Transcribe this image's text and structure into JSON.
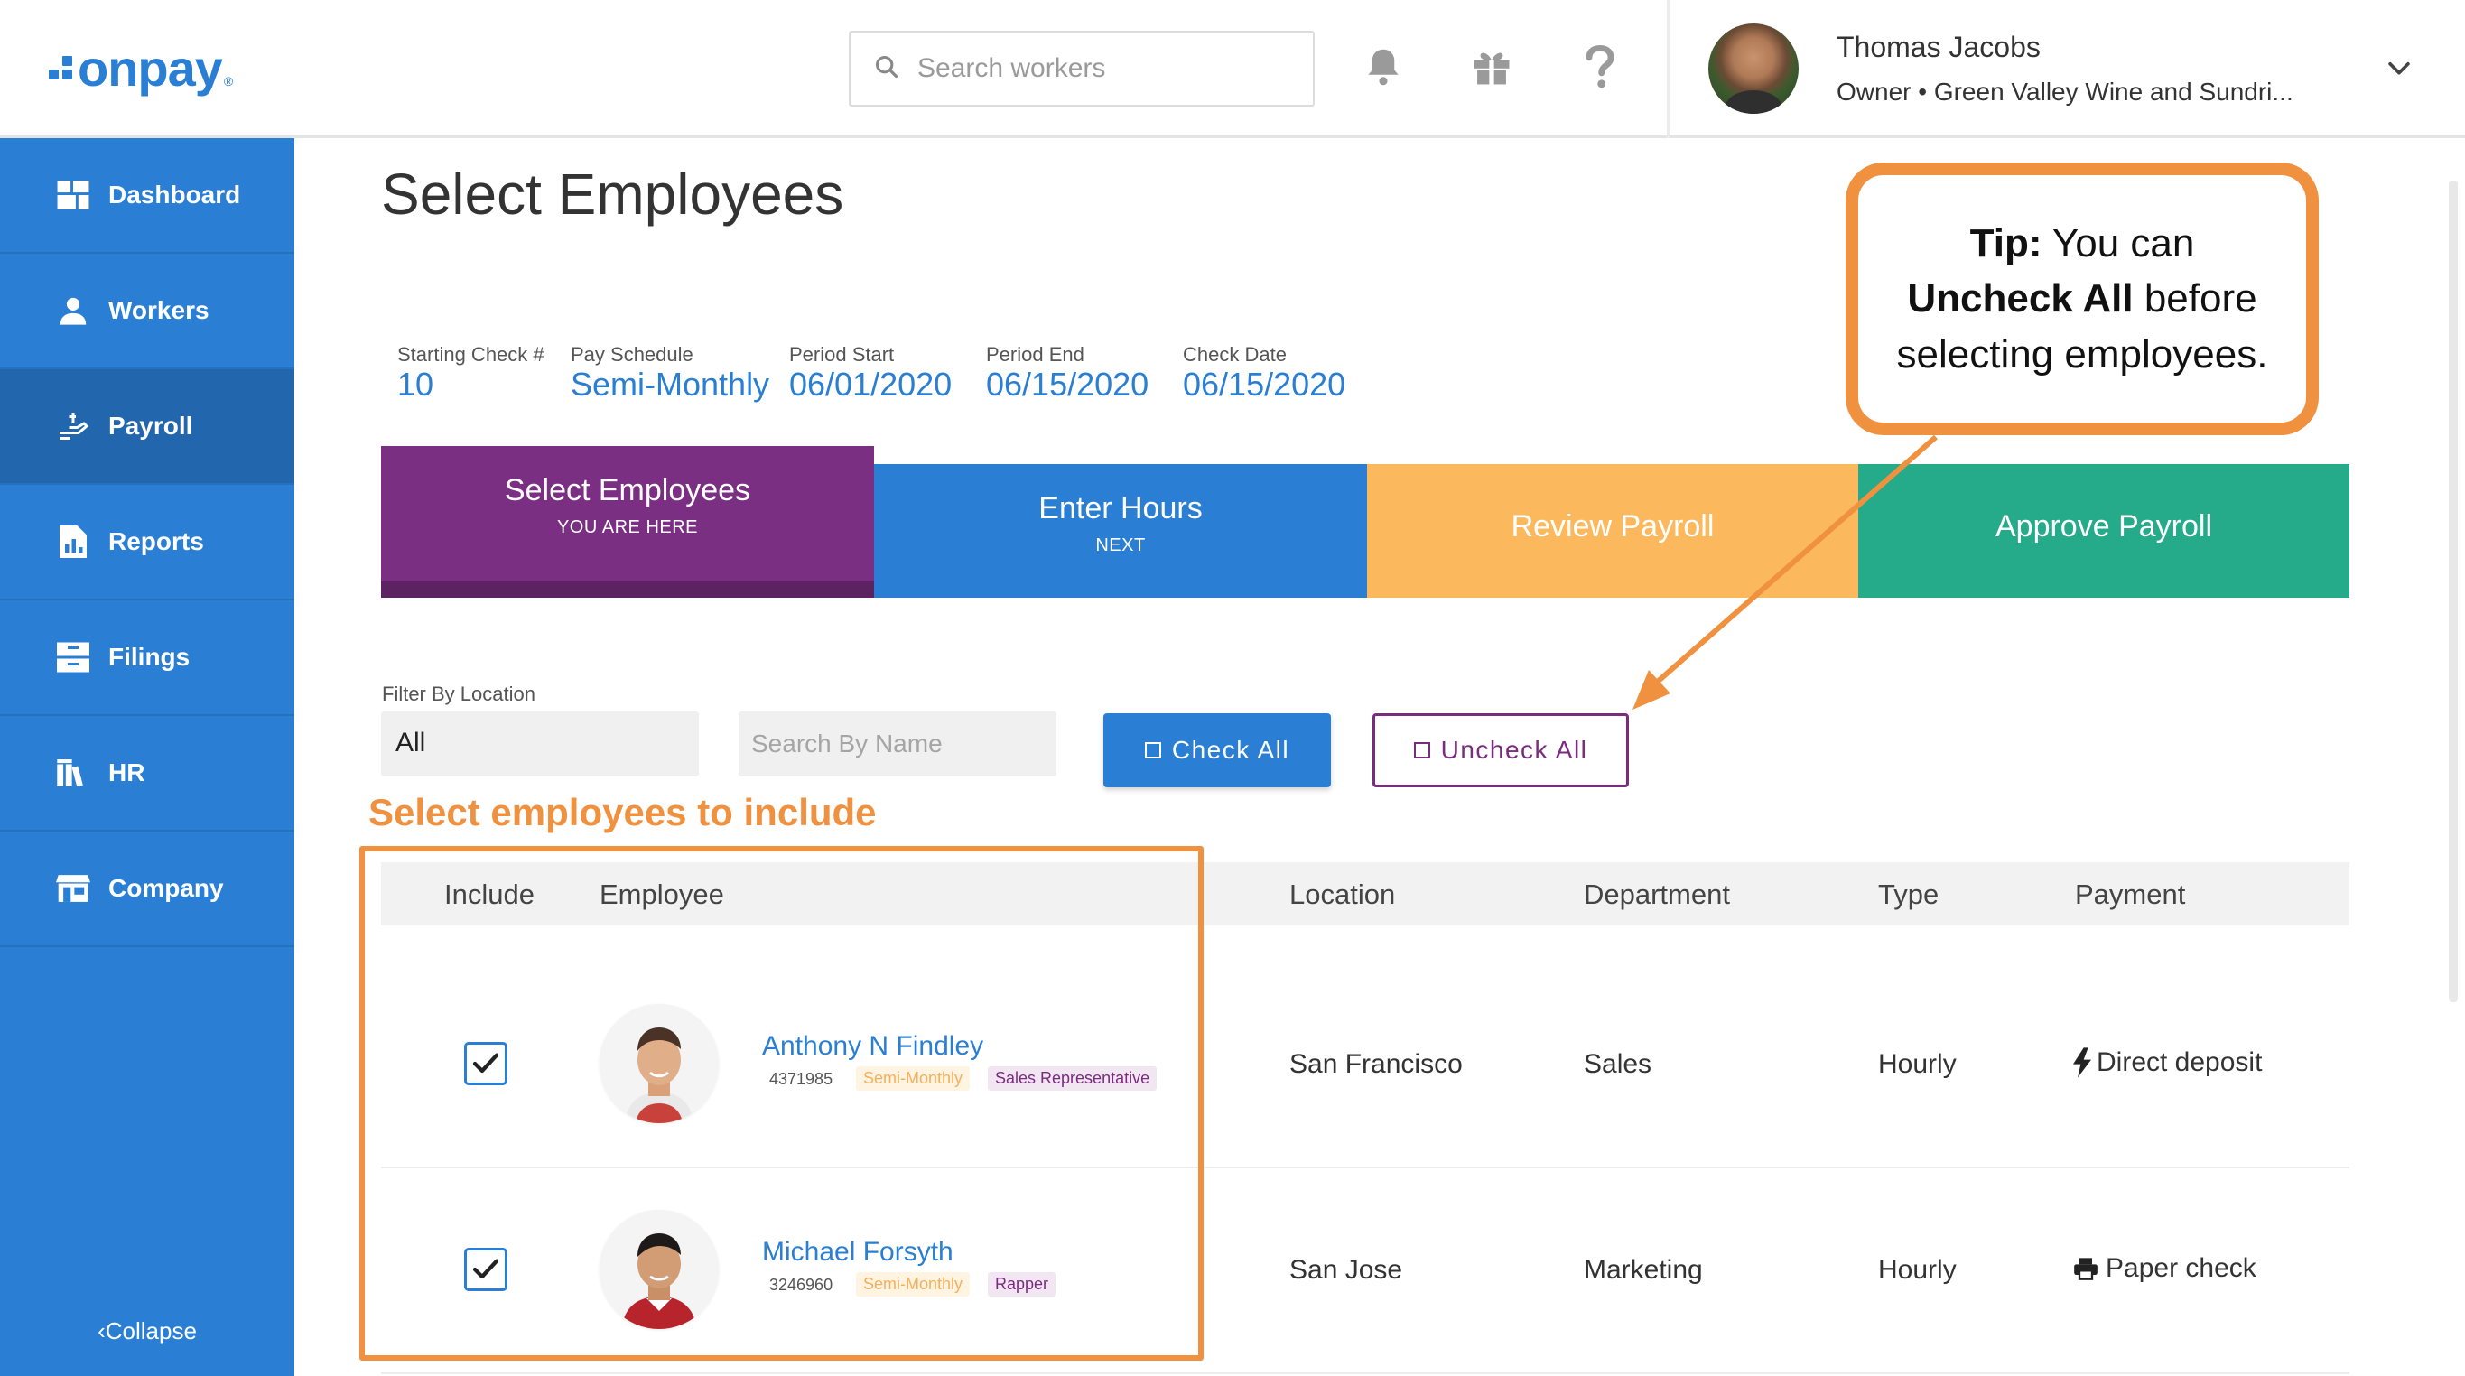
{
  "app": {
    "logo_text": "onpay",
    "logo_reg": "®"
  },
  "header": {
    "search_placeholder": "Search workers",
    "user": {
      "name": "Thomas Jacobs",
      "role": "Owner • Green Valley Wine and Sundri..."
    }
  },
  "sidebar": {
    "items": [
      {
        "label": "Dashboard",
        "icon": "dashboard-icon"
      },
      {
        "label": "Workers",
        "icon": "workers-icon"
      },
      {
        "label": "Payroll",
        "icon": "payroll-icon",
        "active": true
      },
      {
        "label": "Reports",
        "icon": "reports-icon"
      },
      {
        "label": "Filings",
        "icon": "filings-icon"
      },
      {
        "label": "HR",
        "icon": "hr-icon"
      },
      {
        "label": "Company",
        "icon": "company-icon"
      }
    ],
    "collapse_label": "Collapse"
  },
  "page": {
    "title": "Select Employees"
  },
  "meta": [
    {
      "label": "Starting Check #",
      "value": "10"
    },
    {
      "label": "Pay Schedule",
      "value": "Semi-Monthly"
    },
    {
      "label": "Period Start",
      "value": "06/01/2020"
    },
    {
      "label": "Period End",
      "value": "06/15/2020"
    },
    {
      "label": "Check Date",
      "value": "06/15/2020"
    }
  ],
  "steps": [
    {
      "label": "Select Employees",
      "sub": "YOU ARE HERE",
      "color": "#7a2f82"
    },
    {
      "label": "Enter Hours",
      "sub": "NEXT",
      "color": "#2a7fd4"
    },
    {
      "label": "Review Payroll",
      "sub": "",
      "color": "#fbb85c"
    },
    {
      "label": "Approve Payroll",
      "sub": "",
      "color": "#25ab8a"
    }
  ],
  "filters": {
    "location_label": "Filter By Location",
    "location_value": "All",
    "name_placeholder": "Search By Name",
    "check_all": "Check All",
    "uncheck_all": "Uncheck All"
  },
  "table": {
    "headers": [
      "Include",
      "Employee",
      "Location",
      "Department",
      "Type",
      "Payment"
    ],
    "rows": [
      {
        "name": "Anthony N Findley",
        "id": "4371985",
        "schedule": "Semi-Monthly",
        "title": "Sales Representative",
        "location": "San Francisco",
        "department": "Sales",
        "type": "Hourly",
        "payment": "Direct deposit",
        "payment_icon": "bolt-icon",
        "checked": true
      },
      {
        "name": "Michael Forsyth",
        "id": "3246960",
        "schedule": "Semi-Monthly",
        "title": "Rapper",
        "location": "San Jose",
        "department": "Marketing",
        "type": "Hourly",
        "payment": "Paper check",
        "payment_icon": "printer-icon",
        "checked": true
      }
    ]
  },
  "annotations": {
    "select_label": "Select employees to include",
    "tip_bold1": "Tip:",
    "tip_text1": " You can",
    "tip_bold2": "Uncheck All",
    "tip_text2": " before",
    "tip_text3": "selecting employees.",
    "accent_color": "#f0913f"
  }
}
